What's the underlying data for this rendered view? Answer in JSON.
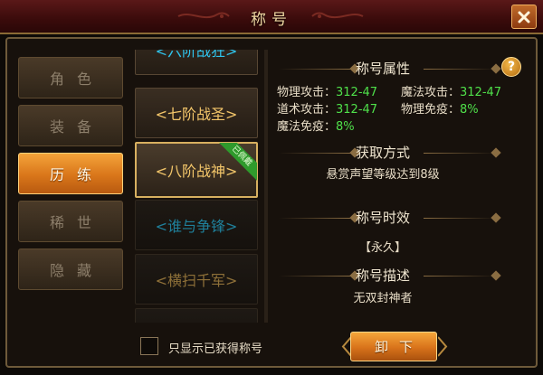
{
  "window": {
    "title": "称号",
    "close_icon": "close-icon"
  },
  "sidebar": {
    "items": [
      {
        "label": "角色",
        "active": false
      },
      {
        "label": "装备",
        "active": false
      },
      {
        "label": "历练",
        "active": true
      },
      {
        "label": "稀世",
        "active": false
      },
      {
        "label": "隐藏",
        "active": false
      }
    ]
  },
  "titles": [
    {
      "label": "<六阶战狂>",
      "color": "#2fc4ec"
    },
    {
      "label": "<七阶战圣>",
      "color": "#f3c66a"
    },
    {
      "label": "<八阶战神>",
      "color": "#f3c66a",
      "selected": true,
      "badge": "已佩戴"
    },
    {
      "label": "<谁与争锋>",
      "color": "#1f7f9a"
    },
    {
      "label": "<横扫千军>",
      "color": "#8e7038"
    }
  ],
  "detail": {
    "help_icon": "question-icon",
    "attributes_title": "称号属性",
    "attributes": {
      "physical_attack_label": "物理攻击：",
      "physical_attack_value": "312-47",
      "magic_attack_label": "魔法攻击：",
      "magic_attack_value": "312-47",
      "taoist_attack_label": "道术攻击：",
      "taoist_attack_value": "312-47",
      "physical_immune_label": "物理免疫：",
      "physical_immune_value": "8%",
      "magic_immune_label": "魔法免疫：",
      "magic_immune_value": "8%"
    },
    "obtain_title": "获取方式",
    "obtain_text": "悬赏声望等级达到8级",
    "duration_title": "称号时效",
    "duration_text": "【永久】",
    "desc_title": "称号描述",
    "desc_text": "无双封神者"
  },
  "footer": {
    "checkbox_label": "只显示已获得称号",
    "checkbox_checked": false,
    "unload_button": "卸下"
  },
  "colors": {
    "accent_orange": "#e08a24",
    "value_green": "#4fe04a",
    "cyan": "#2fc4ec",
    "gold": "#f3c66a"
  }
}
